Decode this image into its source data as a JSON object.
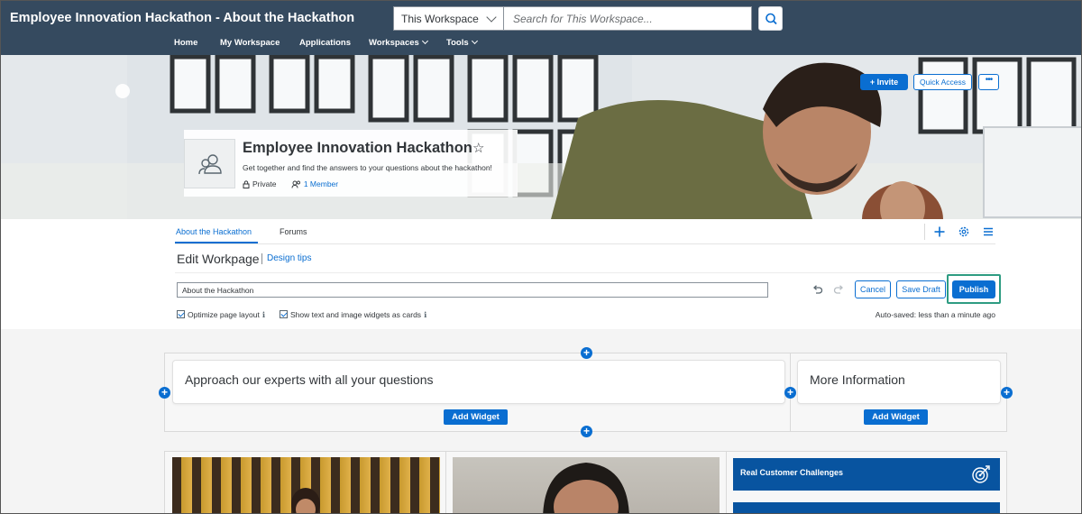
{
  "header": {
    "title": "Employee Innovation Hackathon - About the Hackathon",
    "scope_select": "This Workspace",
    "search_placeholder": "Search for This Workspace...",
    "nav": [
      {
        "label": "Home"
      },
      {
        "label": "My Workspace"
      },
      {
        "label": "Applications"
      },
      {
        "label": "Workspaces"
      },
      {
        "label": "Tools"
      }
    ]
  },
  "hero": {
    "workspace_title": "Employee Innovation Hackathon",
    "description": "Get together and find the answers to your questions about the hackathon!",
    "privacy": "Private",
    "members": "1 Member",
    "invite_label": "Invite",
    "quick_access_label": "Quick Access",
    "more_label": "•••"
  },
  "tabs": [
    {
      "label": "About the Hackathon",
      "active": true
    },
    {
      "label": "Forums",
      "active": false
    }
  ],
  "editor": {
    "title": "Edit Workpage",
    "design_tips": "Design tips",
    "page_name": "About the Hackathon",
    "cancel_label": "Cancel",
    "save_draft_label": "Save Draft",
    "publish_label": "Publish",
    "optimize_label": "Optimize page layout",
    "cards_label": "Show text and image widgets as cards",
    "autosave": "Auto-saved: less than a minute ago"
  },
  "layout": {
    "widget_left_title": "Approach our experts with all your questions",
    "widget_right_title": "More Information",
    "add_widget_label": "Add Widget"
  },
  "tiles": [
    {
      "label": "Real Customer Challenges"
    },
    {
      "label": ""
    }
  ],
  "colors": {
    "header_bg": "#354a5f",
    "accent": "#0a6ed1",
    "highlight": "#2e9c82",
    "tile_bg": "#0854a0"
  }
}
